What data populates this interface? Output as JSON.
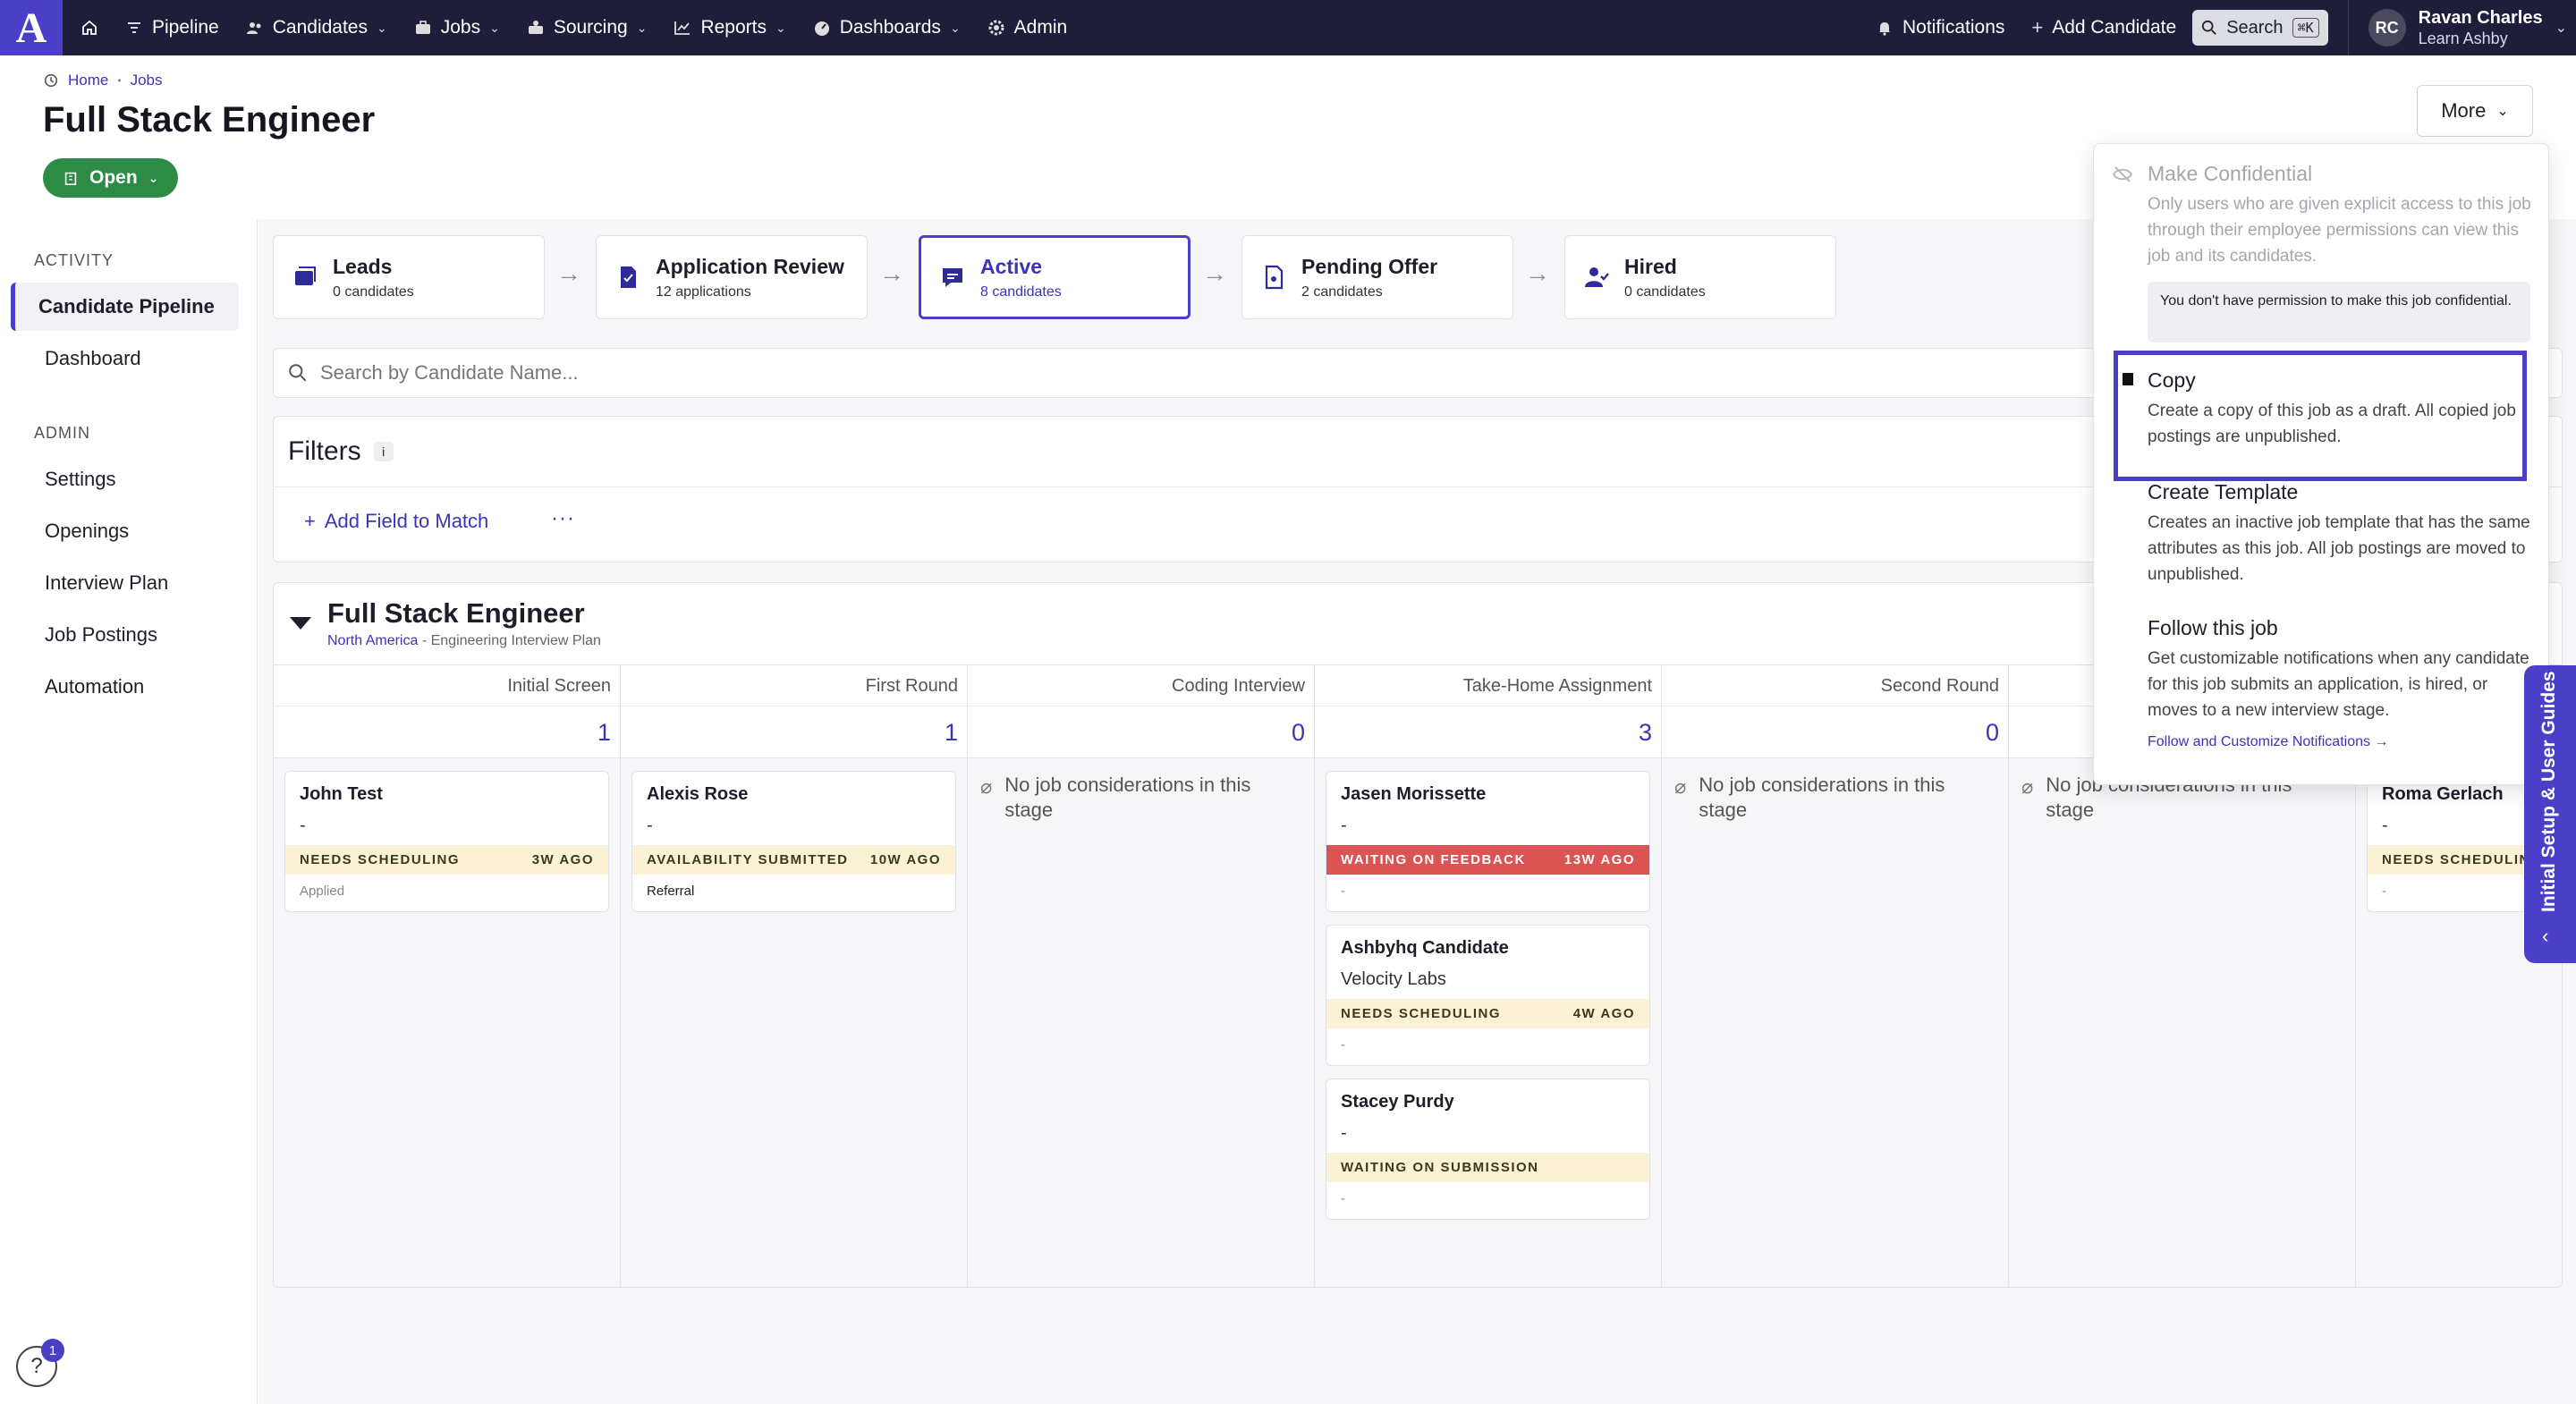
{
  "nav": {
    "logo": "A",
    "items": [
      {
        "label": "Pipeline",
        "icon": "filter-icon",
        "dropdown": false
      },
      {
        "label": "Candidates",
        "icon": "people-icon",
        "dropdown": true
      },
      {
        "label": "Jobs",
        "icon": "briefcase-icon",
        "dropdown": true
      },
      {
        "label": "Sourcing",
        "icon": "sourcing-icon",
        "dropdown": true
      },
      {
        "label": "Reports",
        "icon": "chart-icon",
        "dropdown": true
      },
      {
        "label": "Dashboards",
        "icon": "gauge-icon",
        "dropdown": true
      },
      {
        "label": "Admin",
        "icon": "gear-icon",
        "dropdown": false
      }
    ],
    "notifications": "Notifications",
    "add_candidate": "Add Candidate",
    "search": "Search",
    "search_shortcut": "⌘K",
    "user": {
      "initials": "RC",
      "name": "Ravan Charles",
      "org": "Learn Ashby"
    }
  },
  "header": {
    "breadcrumb": [
      "Home",
      "Jobs"
    ],
    "title": "Full Stack Engineer",
    "status": "Open",
    "more": "More"
  },
  "sidebar": {
    "section_activity": "ACTIVITY",
    "activity_items": [
      "Candidate Pipeline",
      "Dashboard"
    ],
    "section_admin": "ADMIN",
    "admin_items": [
      "Settings",
      "Openings",
      "Interview Plan",
      "Job Postings",
      "Automation"
    ]
  },
  "stages": [
    {
      "title": "Leads",
      "count": "0 candidates"
    },
    {
      "title": "Application Review",
      "count": "12 applications"
    },
    {
      "title": "Active",
      "count": "8 candidates"
    },
    {
      "title": "Pending Offer",
      "count": "2 candidates"
    },
    {
      "title": "Hired",
      "count": "0 candidates"
    }
  ],
  "search_placeholder": "Search by Candidate Name...",
  "filters": {
    "title": "Filters",
    "info": "i",
    "add_field": "Add Field to Match",
    "more": "···"
  },
  "board": {
    "title": "Full Stack Engineer",
    "subtitle_region": "North America",
    "subtitle_plan": " - Engineering Interview Plan",
    "empty_text": "No job considerations in this stage",
    "columns": [
      {
        "name": "Initial Screen",
        "count": "1"
      },
      {
        "name": "First Round",
        "count": "1"
      },
      {
        "name": "Coding Interview",
        "count": "0"
      },
      {
        "name": "Take-Home Assignment",
        "count": "3"
      },
      {
        "name": "Second Round",
        "count": "0"
      },
      {
        "name": "",
        "count": ""
      },
      {
        "name": "",
        "count": ""
      }
    ],
    "cards": {
      "john": {
        "name": "John Test",
        "sub": "-",
        "tag": "NEEDS SCHEDULING",
        "age": "3W AGO",
        "foot": "Applied"
      },
      "alexis": {
        "name": "Alexis Rose",
        "sub": "-",
        "tag": "AVAILABILITY SUBMITTED",
        "age": "10W AGO",
        "foot": "Referral"
      },
      "jasen": {
        "name": "Jasen Morissette",
        "sub": "-",
        "tag": "WAITING ON FEEDBACK",
        "age": "13W AGO",
        "foot": "-"
      },
      "ashbyhq": {
        "name": "Ashbyhq Candidate",
        "sub": "Velocity Labs",
        "tag": "NEEDS SCHEDULING",
        "age": "4W AGO",
        "foot": "-"
      },
      "stacey": {
        "name": "Stacey Purdy",
        "sub": "-",
        "tag": "WAITING ON SUBMISSION",
        "age": "",
        "foot": "-"
      },
      "roma": {
        "name": "Roma Gerlach",
        "sub": "-",
        "tag": "NEEDS SCHEDULIN",
        "age": "",
        "foot": "-"
      }
    }
  },
  "menu": {
    "confidential": {
      "title": "Make Confidential",
      "desc": "Only users who are given explicit access to this job through their employee permissions can view this job and its candidates."
    },
    "permission_note": "You don't have permission to make this job confidential.",
    "copy": {
      "title": "Copy",
      "desc": "Create a copy of this job as a draft. All copied job postings are unpublished."
    },
    "template": {
      "title": "Create Template",
      "desc": "Creates an inactive job template that has the same attributes as this job. All job postings are moved to unpublished."
    },
    "follow": {
      "title": "Follow this job",
      "desc": "Get customizable notifications when any can­didate for this job submits an application, is hired, or moves to a new interview stage.",
      "link": "Follow and Customize Notifications →"
    }
  },
  "guide": {
    "label": "Initial Setup & User Guides"
  },
  "help": {
    "icon": "?",
    "badge": "1"
  },
  "colors": {
    "nav_bg": "#1f1e3a",
    "accent": "#4b3fc7",
    "open_green": "#2e8b45",
    "waiting_red": "#db5353",
    "scheduling_yellow": "#fbf1d4"
  }
}
